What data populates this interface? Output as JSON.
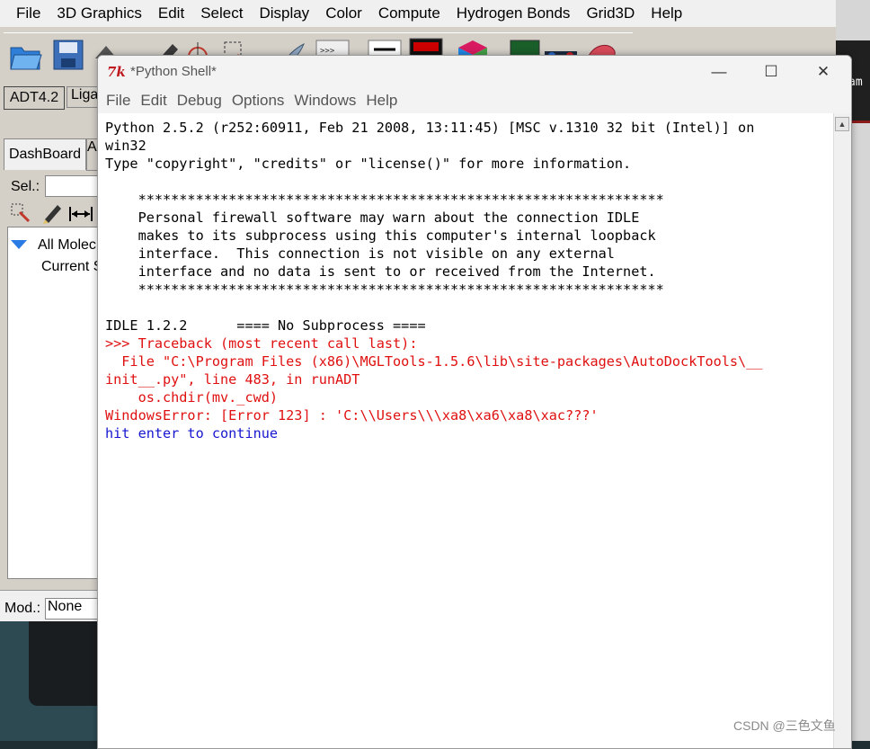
{
  "adt": {
    "menu": [
      "File",
      "3D Graphics",
      "Edit",
      "Select",
      "Display",
      "Color",
      "Compute",
      "Hydrogen Bonds",
      "Grid3D",
      "Help"
    ],
    "tab_adt": "ADT4.2",
    "tab_ligand": "Liga",
    "dashboard_tab": "DashBoard",
    "dashboard_tab2": "A",
    "sel_label": "Sel.:",
    "tree_all_molecules": "All Molec",
    "tree_current": "Current S",
    "mod_label": "Mod.:",
    "mod_value": "None"
  },
  "side_text": "am",
  "shell": {
    "title": "*Python Shell*",
    "tk_logo": "7k",
    "menu": [
      "File",
      "Edit",
      "Debug",
      "Options",
      "Windows",
      "Help"
    ],
    "lines": [
      {
        "text": "Python 2.5.2 (r252:60911, Feb 21 2008, 13:11:45) [MSC v.1310 32 bit (Intel)] on",
        "color": "blk"
      },
      {
        "text": "win32",
        "color": "blk"
      },
      {
        "text": "Type \"copyright\", \"credits\" or \"license()\" for more information.",
        "color": "blk"
      },
      {
        "text": "",
        "color": "blk"
      },
      {
        "text": "    ****************************************************************",
        "color": "blk"
      },
      {
        "text": "    Personal firewall software may warn about the connection IDLE",
        "color": "blk"
      },
      {
        "text": "    makes to its subprocess using this computer's internal loopback",
        "color": "blk"
      },
      {
        "text": "    interface.  This connection is not visible on any external",
        "color": "blk"
      },
      {
        "text": "    interface and no data is sent to or received from the Internet.",
        "color": "blk"
      },
      {
        "text": "    ****************************************************************",
        "color": "blk"
      },
      {
        "text": "",
        "color": "blk"
      },
      {
        "text": "IDLE 1.2.2      ==== No Subprocess ====",
        "color": "blk"
      },
      {
        "text": ">>> Traceback (most recent call last):",
        "color": "red"
      },
      {
        "text": "  File \"C:\\Program Files (x86)\\MGLTools-1.5.6\\lib\\site-packages\\AutoDockTools\\__",
        "color": "red"
      },
      {
        "text": "init__.py\", line 483, in runADT",
        "color": "red"
      },
      {
        "text": "    os.chdir(mv._cwd)",
        "color": "red"
      },
      {
        "text": "WindowsError: [Error 123] : 'C:\\\\Users\\\\\\xa8\\xa6\\xa8\\xac???'",
        "color": "red"
      },
      {
        "text": "hit enter to continue",
        "color": "blu"
      }
    ],
    "minimize_glyph": "—",
    "maximize_glyph": "☐",
    "close_glyph": "✕",
    "scroll_up_glyph": "▲"
  },
  "watermark": "CSDN @三色文鱼"
}
